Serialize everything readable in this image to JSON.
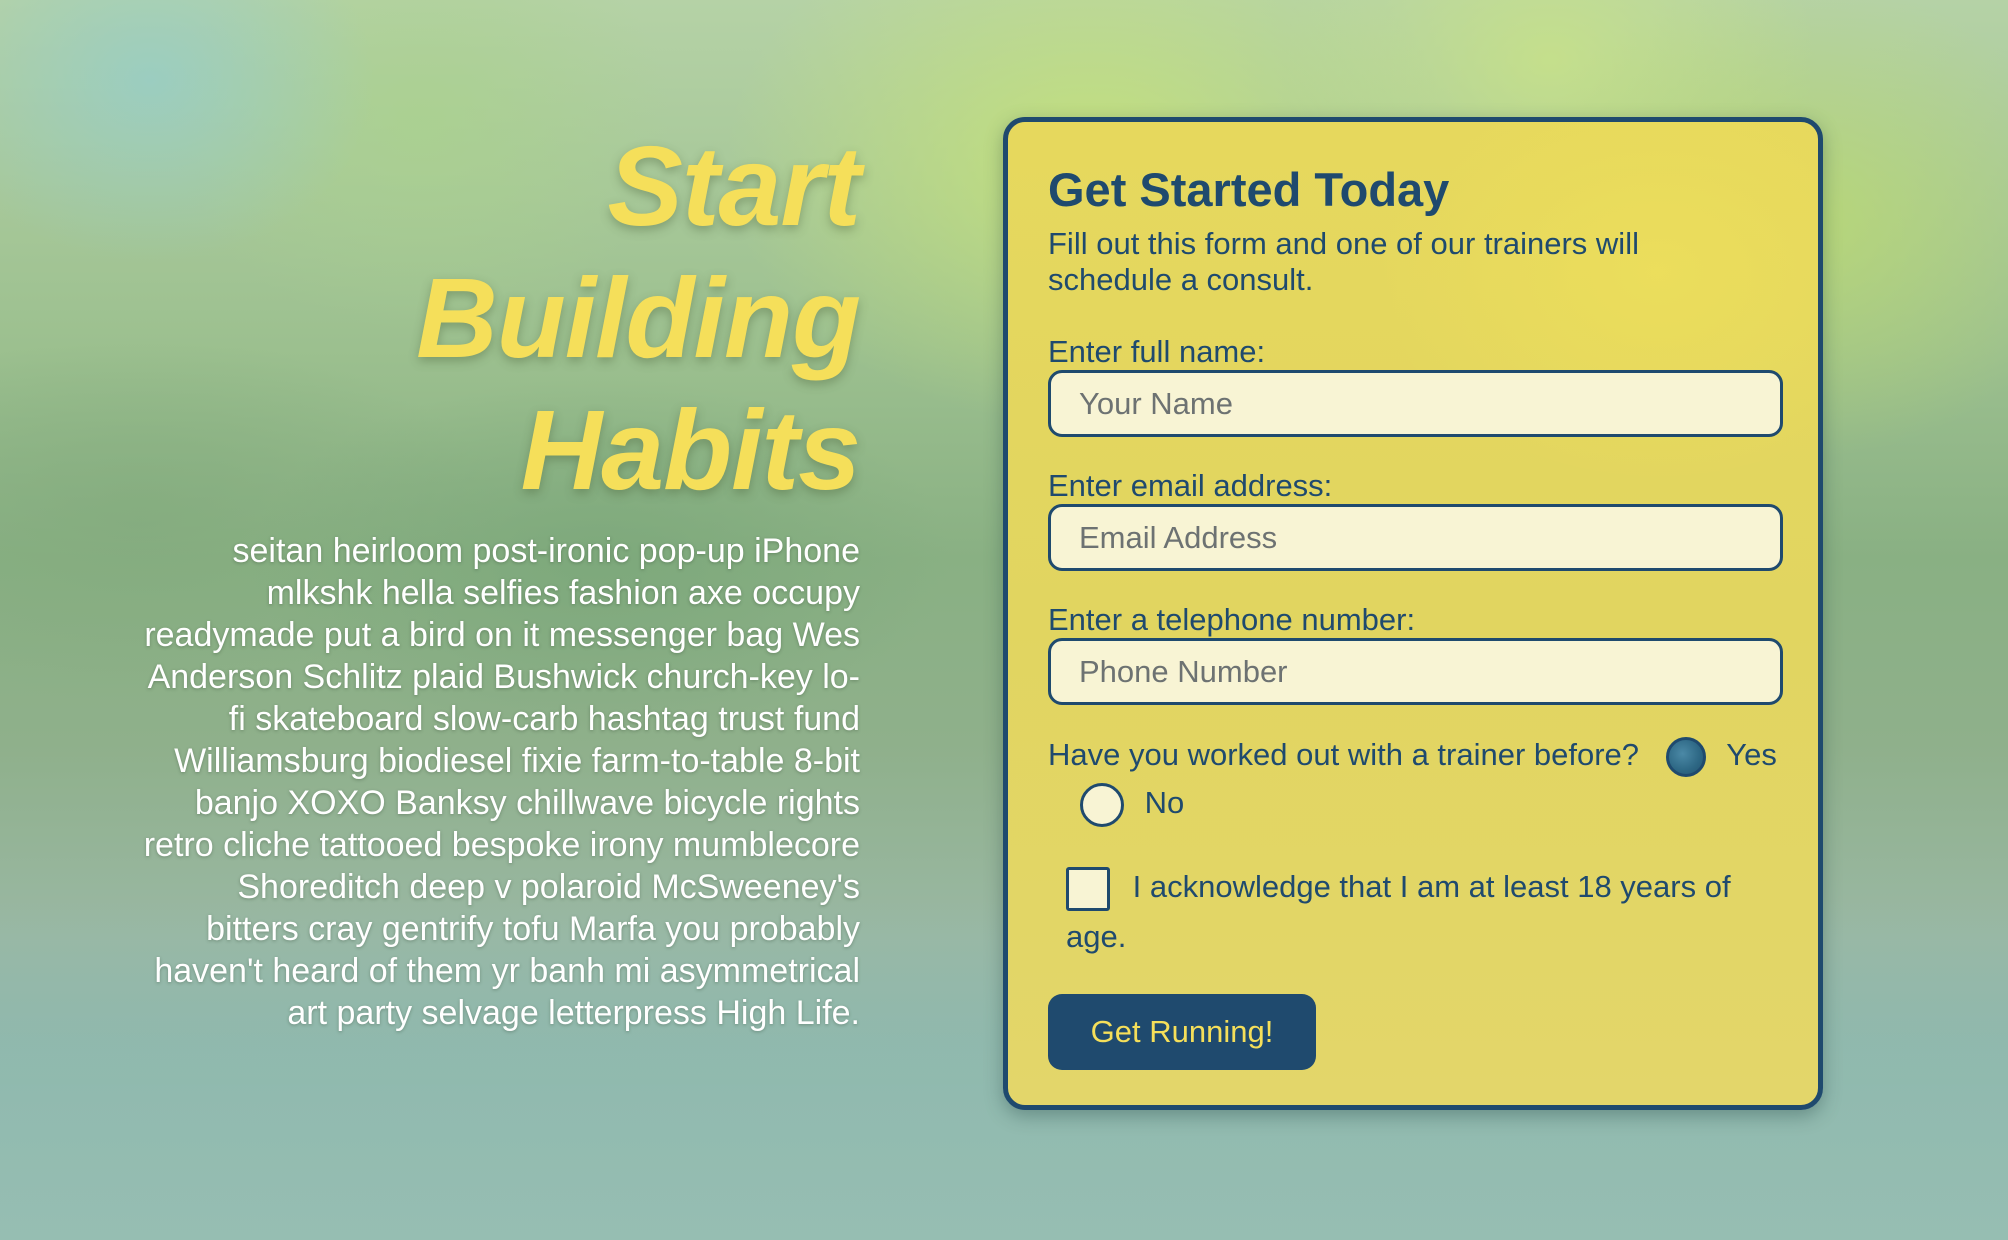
{
  "hero": {
    "title_line1": "Start Building",
    "title_line2": "Habits",
    "body": "seitan heirloom post-ironic pop-up iPhone mlkshk hella selfies fashion axe occupy readymade put a bird on it messenger bag Wes Anderson Schlitz plaid Bushwick church-key lo-fi skateboard slow-carb hashtag trust fund Williamsburg biodiesel fixie farm-to-table 8-bit banjo XOXO Banksy chillwave bicycle rights retro cliche tattooed bespoke irony mumblecore Shoreditch deep v polaroid McSweeney's bitters cray gentrify tofu Marfa you probably haven't heard of them yr banh mi asymmetrical art party selvage letterpress High Life."
  },
  "form": {
    "title": "Get Started Today",
    "intro": "Fill out this form and one of our trainers will schedule a consult.",
    "name": {
      "label": "Enter full name:",
      "placeholder": "Your Name",
      "value": ""
    },
    "email": {
      "label": "Enter email address:",
      "placeholder": "Email Address",
      "value": ""
    },
    "phone": {
      "label": "Enter a telephone number:",
      "placeholder": "Phone Number",
      "value": ""
    },
    "trainer_question": "Have you worked out with a trainer before?",
    "radio_yes": {
      "label": "Yes",
      "selected": true
    },
    "radio_no": {
      "label": "No",
      "selected": false
    },
    "age_checkbox": {
      "label": "I acknowledge that I am at least 18 years of age.",
      "checked": false
    },
    "submit_label": "Get Running!"
  },
  "colors": {
    "accent_yellow": "#f5df5a",
    "navy": "#1f4a6e",
    "card_bg": "#e3d662",
    "input_bg": "#f8f4d4"
  }
}
